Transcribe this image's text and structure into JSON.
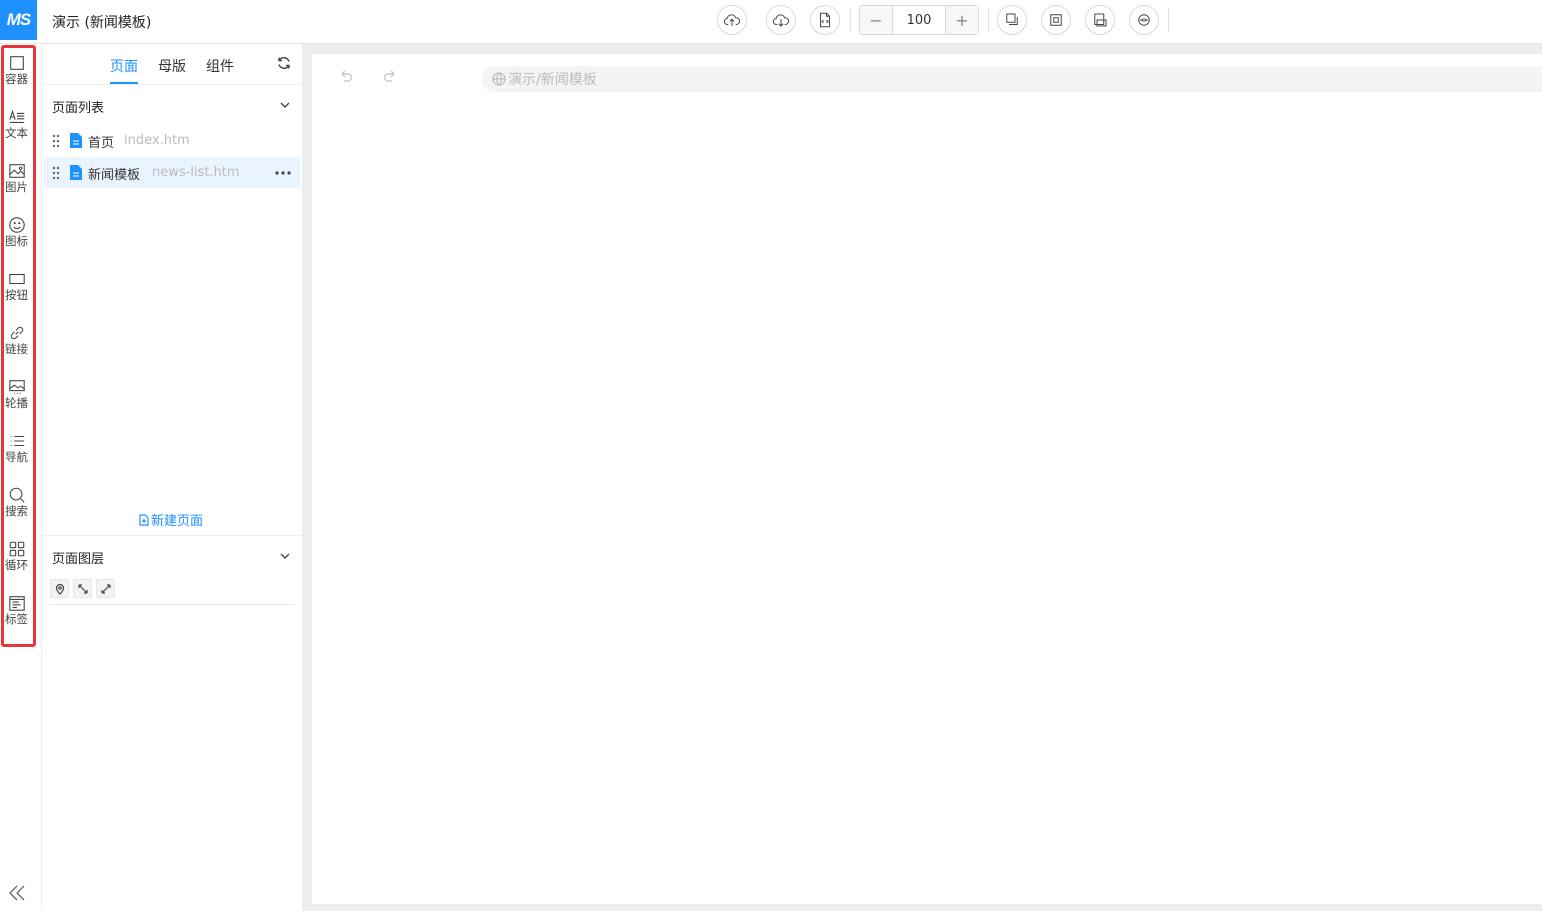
{
  "app": {
    "logo_text": "MS",
    "doc_title": "演示 (新闻模板)"
  },
  "toolbar": {
    "zoom_value": "100",
    "zoom_minus": "−",
    "zoom_plus": "+",
    "icons": [
      "cloud-upload-icon",
      "cloud-download-icon",
      "code-file-icon",
      "layer-front-icon",
      "layer-middle-icon",
      "layer-back-icon",
      "preview-icon"
    ]
  },
  "components": [
    {
      "label": "容器",
      "icon": "container-icon"
    },
    {
      "label": "文本",
      "icon": "text-icon"
    },
    {
      "label": "图片",
      "icon": "image-icon"
    },
    {
      "label": "图标",
      "icon": "smiley-icon"
    },
    {
      "label": "按钮",
      "icon": "button-icon"
    },
    {
      "label": "链接",
      "icon": "link-icon"
    },
    {
      "label": "轮播",
      "icon": "carousel-icon"
    },
    {
      "label": "导航",
      "icon": "nav-list-icon"
    },
    {
      "label": "搜索",
      "icon": "search-icon"
    },
    {
      "label": "循环",
      "icon": "loop-grid-icon"
    },
    {
      "label": "标签",
      "icon": "tag-panel-icon"
    }
  ],
  "panel": {
    "tabs": [
      {
        "label": "页面"
      },
      {
        "label": "母版"
      },
      {
        "label": "组件"
      }
    ],
    "active_tab": 0,
    "page_list_title": "页面列表",
    "pages": [
      {
        "name": "首页",
        "file": "index.htm",
        "selected": false
      },
      {
        "name": "新闻模板",
        "file": "news-list.htm",
        "selected": true
      }
    ],
    "new_page_label": "新建页面",
    "layers_title": "页面图层"
  },
  "canvas": {
    "url": "演示/新闻模板"
  },
  "colors": {
    "accent": "#1e90ff",
    "highlight_box": "#e8343a",
    "selected_row": "#eaf4fe"
  }
}
